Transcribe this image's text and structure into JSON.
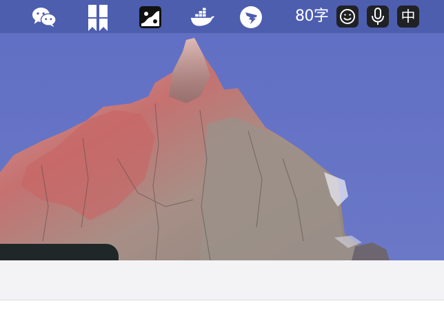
{
  "menubar": {
    "status_items": [
      {
        "icon": "wechat-icon"
      },
      {
        "icon": "bookmark-app-icon"
      },
      {
        "icon": "yinyang-app-icon"
      },
      {
        "icon": "docker-icon"
      },
      {
        "icon": "dingtalk-icon"
      }
    ],
    "word_count": "80字",
    "input_method": {
      "emoji_icon": "smiley-face-icon",
      "voice_icon": "microphone-icon",
      "language": "中"
    }
  },
  "colors": {
    "menubar_bg": "#4c5cae",
    "wallpaper_sky": "#6472c6",
    "rock_pink": "#c96b6b",
    "toolbar_bg": "#f3f3f6",
    "ime_button_bg": "#1f2124"
  }
}
